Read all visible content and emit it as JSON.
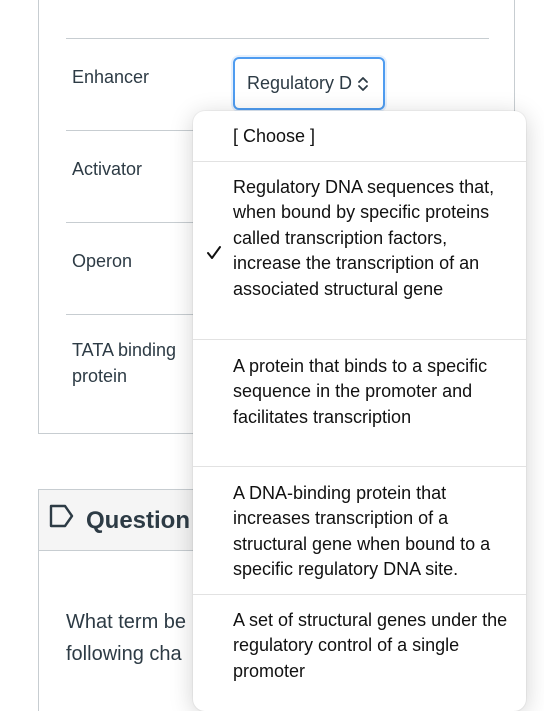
{
  "matching": {
    "rows": [
      {
        "term": "Enhancer"
      },
      {
        "term": "Activator"
      },
      {
        "term": "Operon"
      },
      {
        "term": "TATA binding protein"
      }
    ],
    "select": {
      "value": "Regulatory D"
    }
  },
  "dropdown": {
    "options": [
      {
        "label": "[ Choose ]",
        "selected": false
      },
      {
        "label": "Regulatory DNA sequences that, when bound by specific proteins called transcription factors, increase the transcription of an associated structural gene",
        "selected": true
      },
      {
        "label": "A protein that binds to a specific sequence in the promoter and facilitates transcription",
        "selected": false
      },
      {
        "label": "A DNA-binding protein that increases transcription of a structural gene when bound to a specific regulatory DNA site.",
        "selected": false
      },
      {
        "label": "A set of structural genes under the regulatory control of a single promoter",
        "selected": false
      }
    ]
  },
  "question": {
    "title": "Question",
    "text_line1": "What term be",
    "text_line2": "following cha"
  },
  "colors": {
    "accent": "#4f9cf0",
    "border": "#c7cdd1",
    "text": "#2d3b45"
  }
}
